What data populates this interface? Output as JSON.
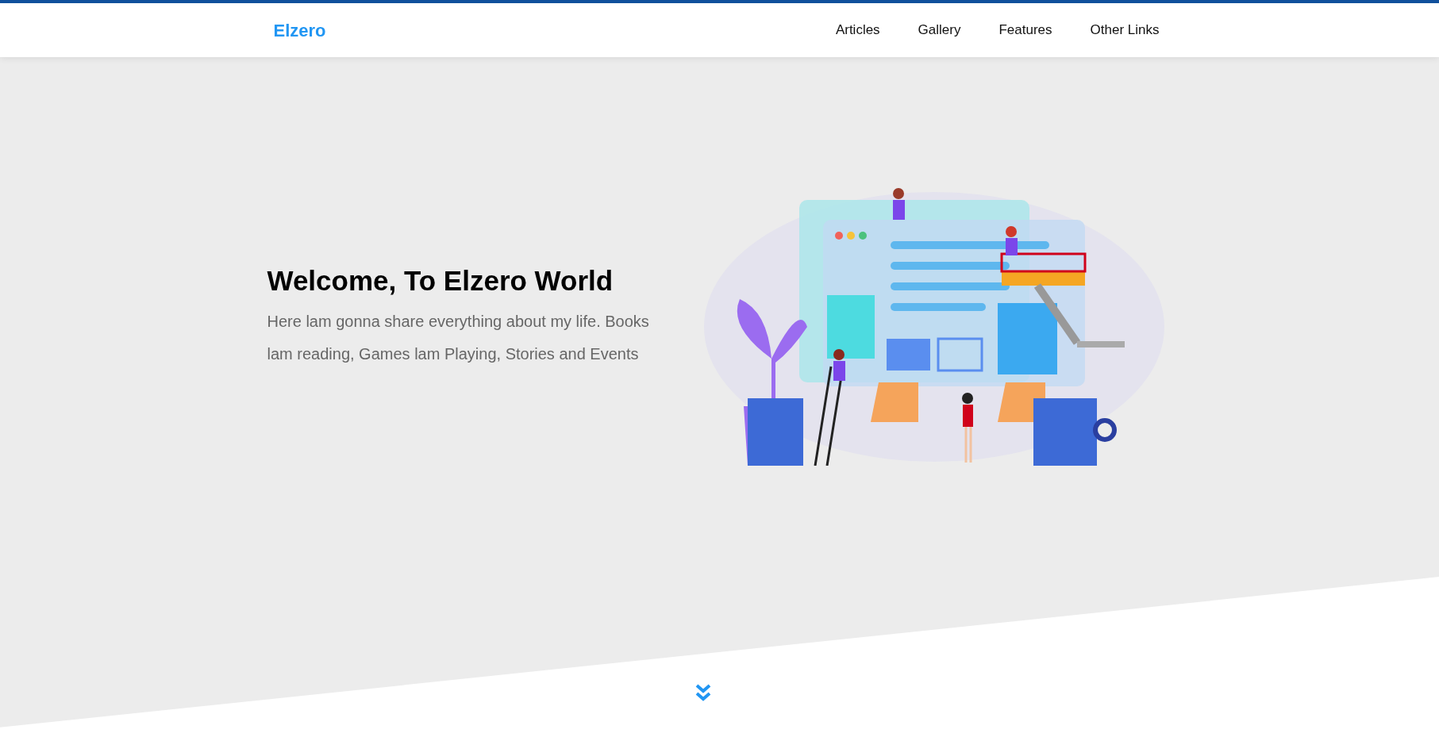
{
  "header": {
    "logo": "Elzero",
    "nav": [
      {
        "label": "Articles"
      },
      {
        "label": "Gallery"
      },
      {
        "label": "Features"
      },
      {
        "label": "Other Links"
      }
    ]
  },
  "hero": {
    "title": "Welcome, To Elzero World",
    "text": "Here lam gonna share everything about my life. Books lam reading, Games lam Playing, Stories and Events"
  }
}
